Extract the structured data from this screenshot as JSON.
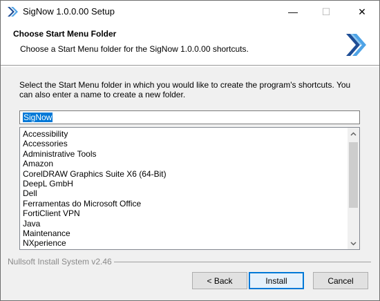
{
  "window": {
    "title": "SigNow 1.0.0.00 Setup",
    "minimize_glyph": "—",
    "maximize_glyph": "☐",
    "close_glyph": "✕"
  },
  "header": {
    "title": "Choose Start Menu Folder",
    "subtitle": "Choose a Start Menu folder for the SigNow 1.0.0.00 shortcuts.",
    "logo_icon": "nsis-chevron-logo"
  },
  "body": {
    "instructions": "Select the Start Menu folder in which you would like to create the program's shortcuts. You can also enter a name to create a new folder.",
    "folder_value": "SigNow",
    "folders": [
      "Accessibility",
      "Accessories",
      "Administrative Tools",
      "Amazon",
      "CorelDRAW Graphics Suite X6 (64-Bit)",
      "DeepL GmbH",
      "Dell",
      "Ferramentas do Microsoft Office",
      "FortiClient VPN",
      "Java",
      "Maintenance",
      "NXperience"
    ]
  },
  "footer": {
    "branding": "Nullsoft Install System v2.46",
    "back_label": "< Back",
    "install_label": "Install",
    "cancel_label": "Cancel"
  },
  "colors": {
    "accent": "#0078d7",
    "logo_dark": "#1f4e96",
    "logo_light": "#4ea3e6"
  }
}
